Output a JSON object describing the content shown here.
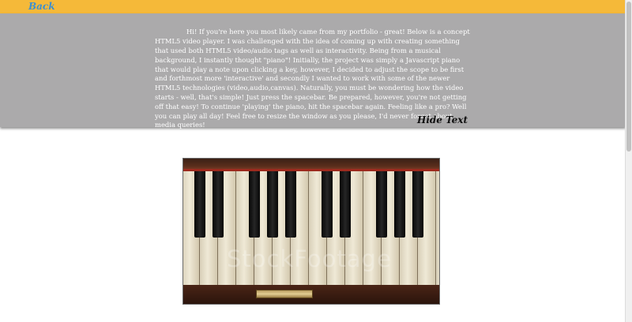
{
  "header": {
    "back_label": "Back"
  },
  "intro": {
    "text": "Hi! If you're here you most likely came from my portfolio - great! Below is a concept HTML5 video player. I was challenged with the idea of coming up with creating something that used both HTML5 video/audio tags as well as interactivity. Being from a musical background, I instantly thought \"piano\"! Initially, the project was simply a Javascript piano that would play a note upon clicking a key, however, I decided to adjust the scope to be first and forthmost more 'interactive' and secondly I wanted to work with some of the newer HTML5 technologies (video,audio,canvas). Naturally, you must be wondering how the video starts - well, that's simple! Just press the spacebar. Be prepared, however, you're not getting off that easy! To continue 'playing' the piano, hit the spacebar again. Feeling like a pro? Well you can play all day! Feel free to resize the window as you please, I'd never forget about media queries!",
    "hide_label": "Hide Text"
  },
  "video": {
    "watermark": "StockFootage",
    "colors": {
      "wood": "#3a2015",
      "trim": "#9c2a1e",
      "ivory": "#efe9d6",
      "ebony": "#0b0b0b"
    }
  }
}
